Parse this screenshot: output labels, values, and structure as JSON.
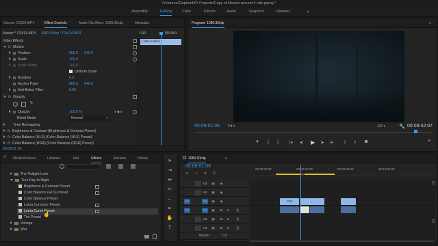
{
  "window": {
    "title": "/Volumes/Elephant/Pr Projects/Copy of Messin around 4 tuts.prproj *"
  },
  "workspaces": {
    "items": [
      "Assembly",
      "Editing",
      "Color",
      "Effects",
      "Audio",
      "Graphics",
      "Libraries"
    ],
    "active": "Editing",
    "more": "»"
  },
  "source_panel": {
    "tabs": [
      "Source: C0595.MP4",
      "Effect Controls",
      "Audio Clip Mixer: 1080:30clip",
      "Metadata"
    ],
    "active_tab": "Effect Controls",
    "more": "≡",
    "master_label": "Master * C0414.MP4",
    "sequence_label": "1080:30clip * C0414.MP4",
    "mini_timecode": "00:09:0",
    "clip_chip": "C0414.MP4",
    "ruler_start": "1:00",
    "video_effects_label": "Video Effects",
    "rows": [
      {
        "label": "Motion",
        "kind": "section"
      },
      {
        "label": "Position",
        "v1": "960.0",
        "v2": "540.0"
      },
      {
        "label": "Scale",
        "v1": "100.0"
      },
      {
        "label": "Scale Width",
        "v1": "100.0",
        "dim": true
      },
      {
        "label": "Uniform Scale",
        "kind": "checkbox"
      },
      {
        "label": "Rotation",
        "v1": "0.0"
      },
      {
        "label": "Anchor Point",
        "v1": "960.0",
        "v2": "540.0"
      },
      {
        "label": "Anti-flicker Filter",
        "v1": "0.00"
      },
      {
        "label": "Opacity",
        "kind": "section"
      },
      {
        "label": "Opacity",
        "v1": "100.0 %"
      },
      {
        "label": "Blend Mode",
        "v1": "Normal"
      },
      {
        "label": "Time Remapping",
        "kind": "collapsed"
      },
      {
        "label": "Brightness & Contrast (Brightness & Contrast Preset)",
        "kind": "fx"
      },
      {
        "label": "Color Balance (HLS) (Color Balance (HLS) Preset)",
        "kind": "fx"
      },
      {
        "label": "Color Balance (RGB) (Color Balance (RGB) Preset)",
        "kind": "fx"
      }
    ],
    "timecode": "00:09:01:06"
  },
  "program": {
    "title": "Program: 1080:30clip",
    "more": "≡",
    "timecode": "00:09:01:06",
    "fit": "Fit",
    "resolution": "1/2",
    "duration": "00:09:42:07"
  },
  "effects_panel": {
    "tabs": [
      "Media Browser",
      "Libraries",
      "Info",
      "Effects",
      "Markers",
      "History"
    ],
    "active_tab": "Effects",
    "more": "»",
    "items": [
      {
        "label": "The Twilight Look",
        "indent": 1,
        "kind": "folder",
        "open": false
      },
      {
        "label": "Turn Day to Night",
        "indent": 1,
        "kind": "folder",
        "open": true
      },
      {
        "label": "Brightness & Contrast Preset",
        "indent": 2,
        "kind": "preset"
      },
      {
        "label": "Color Balance (HLS) Preset",
        "indent": 2,
        "kind": "preset"
      },
      {
        "label": "Color Balance Preset",
        "indent": 2,
        "kind": "preset"
      },
      {
        "label": "Luma Corrector Preset",
        "indent": 2,
        "kind": "preset"
      },
      {
        "label": "Luma Curve Preset",
        "indent": 2,
        "kind": "preset",
        "selected": true
      },
      {
        "label": "Tint Preset",
        "indent": 2,
        "kind": "preset"
      },
      {
        "label": "Vintage",
        "indent": 1,
        "kind": "folder",
        "open": false
      },
      {
        "label": "War",
        "indent": 1,
        "kind": "folder",
        "open": false
      }
    ]
  },
  "timeline": {
    "title": "1080:30clip",
    "more": "≡",
    "timecode": "00:09:01:06",
    "ruler_labels": [
      "00:08:32:00",
      "00:09:04:00",
      "00:09:36:00",
      "00:10:08:00"
    ],
    "video_tracks": [
      {
        "target": "",
        "name": "V3"
      },
      {
        "target": "",
        "name": "V2"
      },
      {
        "target": "V1",
        "name": "V1"
      }
    ],
    "audio_tracks": [
      {
        "target": "A1",
        "name": "A1"
      },
      {
        "target": "",
        "name": "A2"
      },
      {
        "target": "",
        "name": "A3"
      }
    ],
    "master_label": "Master",
    "master_value": "0.0",
    "clip_label": "C04",
    "track_buttons": [
      "M",
      "S"
    ]
  },
  "colors": {
    "accent": "#3d9ae8",
    "video_clip": "#8fb6e6",
    "audio_clip": "#4a6fa0",
    "selected_row": "#3a3a3a",
    "playhead": "#3d9ae8"
  }
}
